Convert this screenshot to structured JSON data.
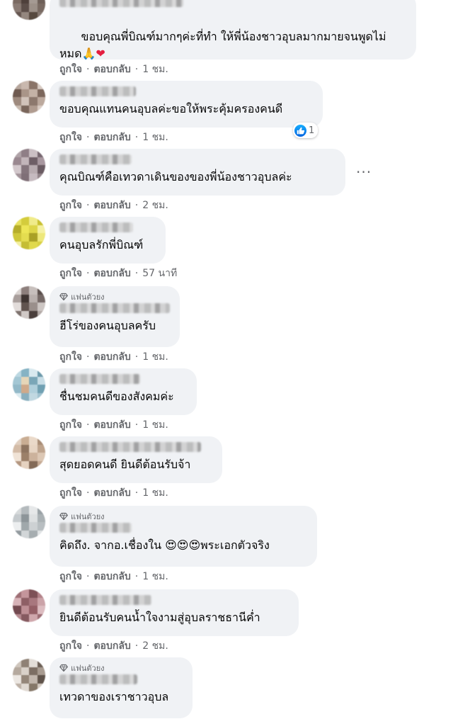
{
  "comments": [
    {
      "text": "ขอบคุณพี่บิณฑ์มากๆค่ะที่ทำ ให้พี่น้องชาวอุบลมากมายจนพูดไม่หมด",
      "emoji_tail": "🙏❤",
      "time": "1 ชม.",
      "fan_badge": false,
      "reactions": null
    },
    {
      "text": "ขอบคุณแทนคนอุบลค่ะขอให้พระคุ้มครองคนดี",
      "emoji_tail": "",
      "time": "1 ชม.",
      "fan_badge": false,
      "reactions": "1"
    },
    {
      "text": "คุณบิณฑ์คือเทวดาเดินของของพี่น้องชาวอุบลค่ะ",
      "emoji_tail": "",
      "time": "2 ชม.",
      "fan_badge": false,
      "reactions": null
    },
    {
      "text": "คนอุบลรักพี่บิณฑ์",
      "emoji_tail": "",
      "time": "57 นาที",
      "fan_badge": false,
      "reactions": null
    },
    {
      "text": "ฮีโร่ของคนอุบลครับ",
      "emoji_tail": "",
      "time": "1 ชม.",
      "fan_badge": true,
      "reactions": null
    },
    {
      "text": "ชื่นชมคนดีของสังคมค่ะ",
      "emoji_tail": "",
      "time": "1 ชม.",
      "fan_badge": false,
      "reactions": null
    },
    {
      "text": "สุดยอดคนดี ยินดีต้อนรับจ้า",
      "emoji_tail": "",
      "time": "1 ชม.",
      "fan_badge": false,
      "reactions": null
    },
    {
      "text": "คิดถึง. จากอ.เชื่องใน 😍😍😍พระเอกตัวจริง",
      "emoji_tail": "",
      "time": "1 ชม.",
      "fan_badge": true,
      "reactions": null
    },
    {
      "text": "ยินดีต้อนรับคนน้ำใจงามสู่อุบลราชธานีค่ำ",
      "emoji_tail": "",
      "time": "2 ชม.",
      "fan_badge": false,
      "reactions": null
    },
    {
      "text": "เทวดาของเราชาวอุบล",
      "emoji_tail": "",
      "time": "",
      "fan_badge": true,
      "reactions": null
    }
  ],
  "labels": {
    "like": "ถูกใจ",
    "reply": "ตอบกลับ",
    "separator": "·",
    "fan": "แฟนตัวยง",
    "more": "···"
  },
  "colors": {
    "bubble": "#f0f2f5",
    "meta": "#65676b",
    "text": "#050505",
    "like_blue": "#1877f2",
    "heart": "#e41e3f"
  },
  "icons": {
    "fan_badge": "diamond-icon",
    "reaction": "like-thumb-icon",
    "more": "more-options-icon"
  }
}
